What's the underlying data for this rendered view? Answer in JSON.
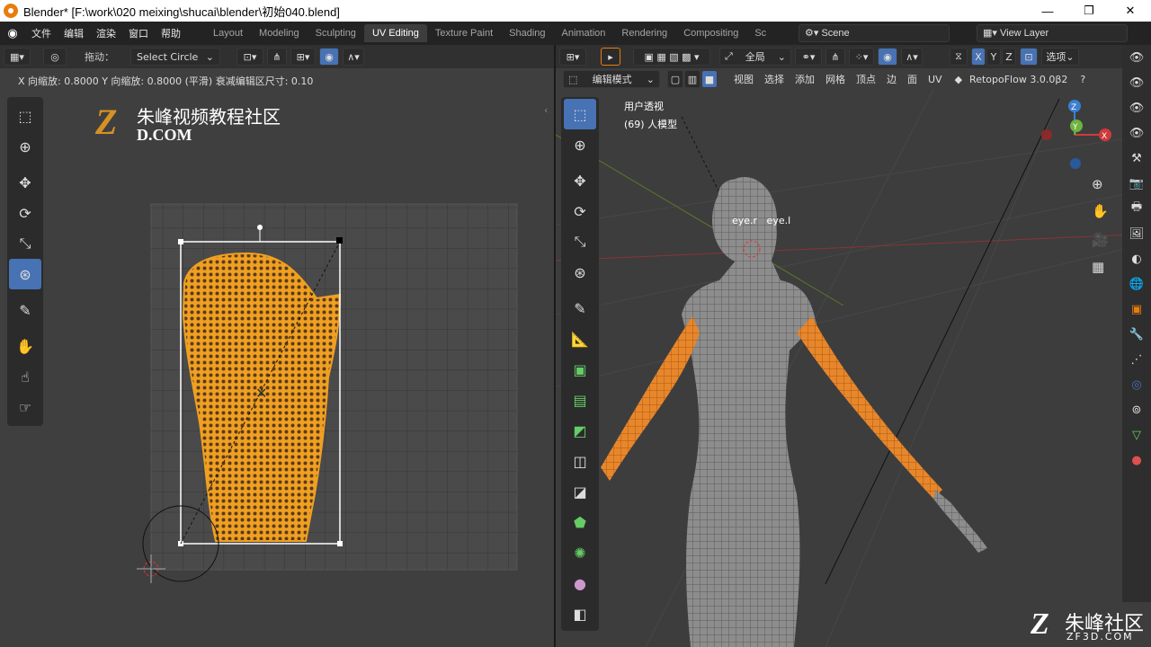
{
  "window": {
    "title": "Blender* [F:\\work\\020 meixing\\shucai\\blender\\初始040.blend]",
    "minimize": "—",
    "maximize": "❐",
    "close": "✕"
  },
  "menu": [
    "文件",
    "编辑",
    "渲染",
    "窗口",
    "帮助"
  ],
  "workspaces": [
    "Layout",
    "Modeling",
    "Sculpting",
    "UV Editing",
    "Texture Paint",
    "Shading",
    "Animation",
    "Rendering",
    "Compositing",
    "Sc"
  ],
  "active_workspace": "UV Editing",
  "scene": {
    "label": "Scene"
  },
  "view_layer": {
    "label": "View Layer"
  },
  "uv_editor": {
    "drag_label": "拖动：",
    "select_mode": "Select Circle",
    "status": "X 向缩放: 0.8000  Y 向缩放: 0.8000 (平滑) 衰减编辑区尺寸: 0.10"
  },
  "viewport": {
    "transform": "全局",
    "options": "选项",
    "mode": "编辑模式",
    "menus": [
      "视图",
      "选择",
      "添加",
      "网格",
      "顶点",
      "边",
      "面",
      "UV"
    ],
    "addon": "RetopoFlow 3.0.0β2",
    "view_name": "用户透视",
    "object_info": "(69) 人模型",
    "eye_labels": "eye.r   eye.l",
    "axes": {
      "x": "X",
      "y": "Y",
      "z": "Z"
    }
  },
  "watermark_top": {
    "line1": "朱峰视频教程社区",
    "line2": "D.COM",
    "logo": "Z"
  },
  "watermark_bottom": {
    "line1": "朱峰社区",
    "line2": "ZF3D.COM",
    "logo": "Z"
  },
  "colors": {
    "accent": "#4772b3",
    "uv_orange": "#f0a020",
    "arm_orange": "#e8872a",
    "title_bg": "#ffffff"
  }
}
